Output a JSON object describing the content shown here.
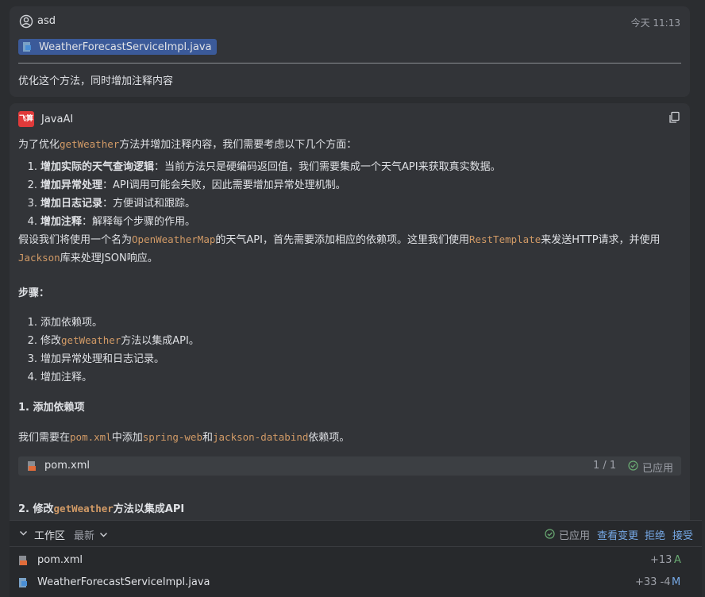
{
  "user_message": {
    "username": "asd",
    "time": "今天 11:13",
    "attachment": "WeatherForecastServiceImpl.java",
    "text": "优化这个方法，同时增加注释内容"
  },
  "ai_message": {
    "logo_text": "飞算",
    "name": "JavaAI",
    "intro": {
      "a": "为了优化",
      "code": "getWeather",
      "b": "方法并增加注释内容，我们需要考虑以下几个方面："
    },
    "aspects": [
      {
        "n": "1.",
        "bold": "增加实际的天气查询逻辑",
        "text": "：当前方法只是硬编码返回值，我们需要集成一个天气API来获取真实数据。"
      },
      {
        "n": "2.",
        "bold": "增加异常处理",
        "text": "：API调用可能会失败，因此需要增加异常处理机制。"
      },
      {
        "n": "3.",
        "bold": "增加日志记录",
        "text": "：方便调试和跟踪。"
      },
      {
        "n": "4.",
        "bold": "增加注释",
        "text": "：解释每个步骤的作用。"
      }
    ],
    "para2": {
      "a": "假设我们将使用一个名为",
      "code1": "OpenWeatherMap",
      "b": "的天气API，首先需要添加相应的依赖项。这里我们使用",
      "code2": "RestTemplate",
      "c": "来发送HTTP请求，并使用",
      "code3": "Jackson",
      "d": "库来处理JSON响应。"
    },
    "steps_title": "步骤：",
    "steps": [
      {
        "n": "1.",
        "a": "添加依赖项。",
        "code": "",
        "b": ""
      },
      {
        "n": "2.",
        "a": "修改",
        "code": "getWeather",
        "b": "方法以集成API。"
      },
      {
        "n": "3.",
        "a": "增加异常处理和日志记录。",
        "code": "",
        "b": ""
      },
      {
        "n": "4.",
        "a": "增加注释。",
        "code": "",
        "b": ""
      }
    ],
    "section1_title": "1. 添加依赖项",
    "section1_text": {
      "a": "我们需要在",
      "code1": "pom.xml",
      "b": "中添加",
      "code2": "spring-web",
      "c": "和",
      "code3": "jackson-databind",
      "d": "依赖项。"
    },
    "code_file": {
      "name": "pom.xml",
      "count": "1 / 1",
      "status": "已应用"
    },
    "section2_title": {
      "a": "2. 修改",
      "code": "getWeather",
      "b": "方法以集成API"
    }
  },
  "workspace": {
    "title": "工作区",
    "filter": "最新",
    "status": "已应用",
    "actions": {
      "view": "查看变更",
      "reject": "拒绝",
      "accept": "接受"
    },
    "files": [
      {
        "name": "pom.xml",
        "diff": "+13",
        "mark": "A"
      },
      {
        "name": "WeatherForecastServiceImpl.java",
        "diff": "+33 -4",
        "mark": "M"
      }
    ]
  },
  "colors": {
    "code": "#d19a66",
    "link": "#76a9e6",
    "added": "#6aab73",
    "chip": "#3b5a99"
  }
}
